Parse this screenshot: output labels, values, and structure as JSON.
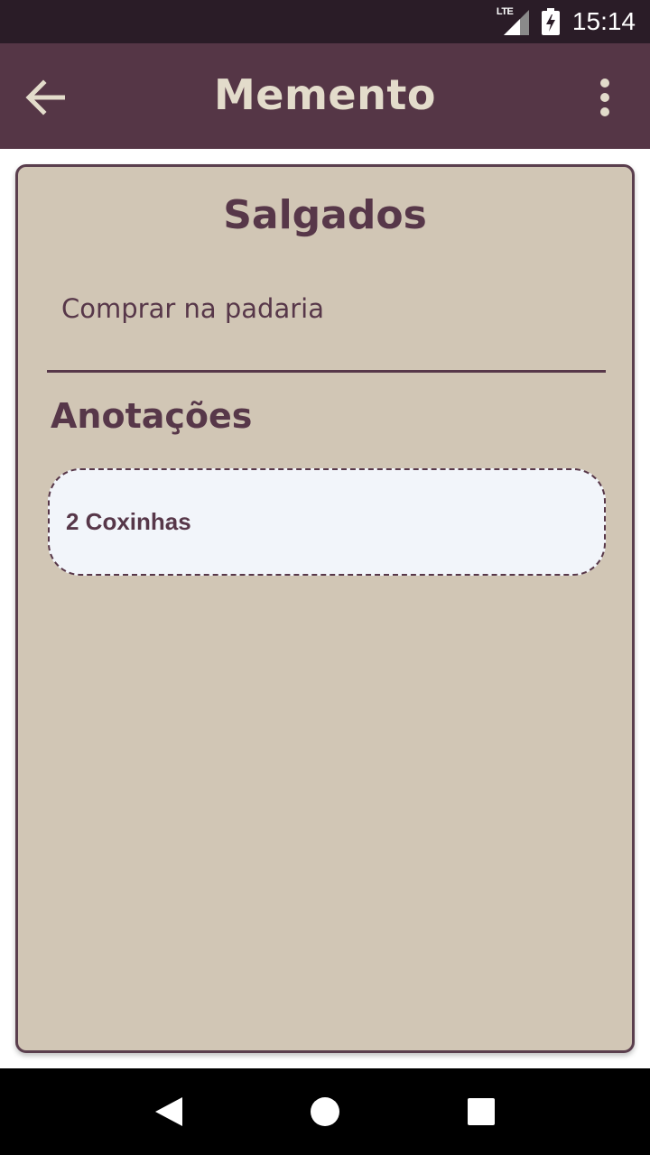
{
  "status_bar": {
    "network": "LTE",
    "time": "15:14",
    "icons": [
      "lte-signal-icon",
      "battery-charging-icon"
    ]
  },
  "app_bar": {
    "title": "Memento",
    "back_icon": "arrow-back-icon",
    "menu_icon": "more-vert-icon"
  },
  "note": {
    "title": "Salgados",
    "description": "Comprar na padaria",
    "annotations_header": "Anotações",
    "annotations": [
      {
        "text": "2 Coxinhas"
      }
    ]
  },
  "nav_bar": {
    "icons": [
      "nav-back-icon",
      "nav-home-icon",
      "nav-recents-icon"
    ]
  },
  "colors": {
    "app_bar": "#553646",
    "title_text": "#e3dccb",
    "card_bg": "#d1c6b5",
    "accent": "#573749",
    "annotation_bg": "#f2f5fa"
  }
}
